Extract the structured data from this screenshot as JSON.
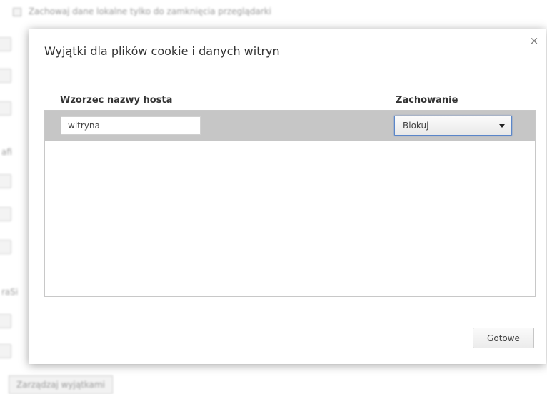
{
  "background": {
    "checkbox_label": "Zachowaj dane lokalne tylko do zamknięcia przeglądarki",
    "fragments": [
      "afi",
      "raSi"
    ],
    "bottom_button": "Zarządzaj wyjątkami"
  },
  "dialog": {
    "title": "Wyjątki dla plików cookie i danych witryn",
    "close_icon": "×",
    "columns": {
      "host": "Wzorzec nazwy hosta",
      "behavior": "Zachowanie"
    },
    "rows": [
      {
        "host_value": "witryna",
        "behavior_value": "Blokuj"
      }
    ],
    "done_button": "Gotowe"
  },
  "colors": {
    "row_selected_bg": "#c6c6c6",
    "select_focus_border": "#5a86c9"
  }
}
